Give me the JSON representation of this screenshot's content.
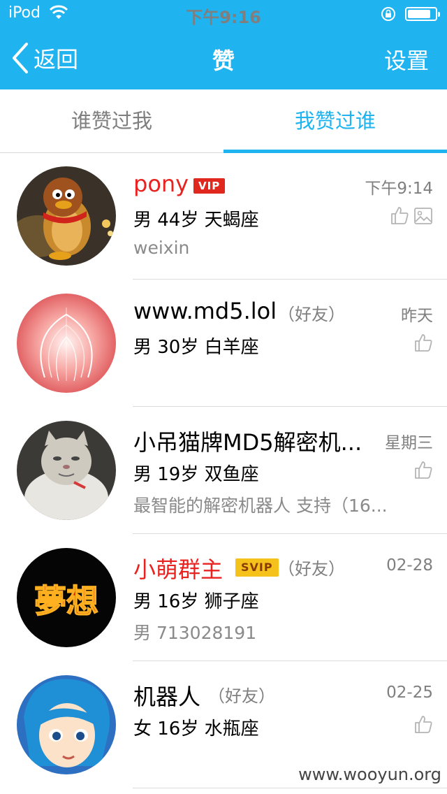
{
  "status_bar": {
    "carrier": "iPod",
    "time": "下午9:16"
  },
  "nav": {
    "back_label": "返回",
    "title": "赞",
    "settings_label": "设置"
  },
  "tabs": [
    {
      "label": "谁赞过我",
      "active": false
    },
    {
      "label": "我赞过谁",
      "active": true
    }
  ],
  "list": [
    {
      "name": "pony",
      "badge": "VIP",
      "friend": "",
      "time": "下午9:14",
      "info": "男 44岁  天蝎座",
      "sign": "weixin",
      "avatar": "penguin-avatar",
      "icons": [
        "thumbs-up-icon",
        "picture-icon"
      ]
    },
    {
      "name": "www.md5.lol",
      "badge": "",
      "friend": "（好友）",
      "time": "昨天",
      "info": "男 30岁  白羊座",
      "sign": "",
      "avatar": "fireworks-avatar",
      "icons": [
        "thumbs-up-icon"
      ]
    },
    {
      "name": "小吊猫牌MD5解密机...",
      "badge": "",
      "friend": "",
      "time": "星期三",
      "info": "男 19岁  双鱼座",
      "sign": "最智能的解密机器人 支持（16...",
      "avatar": "cat-avatar",
      "icons": [
        "thumbs-up-icon"
      ]
    },
    {
      "name": "小萌群主",
      "badge": "SVIP",
      "friend": "（好友）",
      "time": "02-28",
      "info": "男 16岁  狮子座",
      "sign": "男  713028191",
      "avatar": "fire-text-avatar",
      "icons": []
    },
    {
      "name": "机器人",
      "badge": "",
      "friend": "（好友）",
      "time": "02-25",
      "info": "女 16岁  水瓶座",
      "sign": "",
      "avatar": "anime-girl-avatar",
      "icons": [
        "thumbs-up-icon"
      ]
    }
  ],
  "avatar_art_text": "夢想",
  "watermark": "www.wooyun.org",
  "colors": {
    "accent": "#1fb3f0",
    "vip_red": "#e0281e",
    "svip_gold": "#f4c21b",
    "name_red": "#e8231f"
  }
}
